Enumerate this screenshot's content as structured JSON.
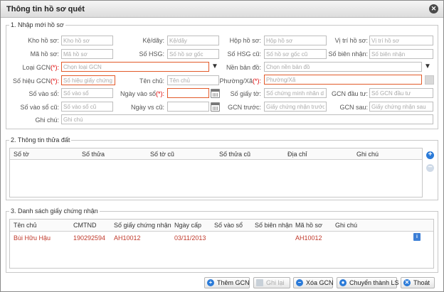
{
  "dialog": {
    "title": "Thông tin hồ sơ quét"
  },
  "section1": {
    "legend": "1. Nhập mới hồ sơ",
    "fields": {
      "kho_ho_so": {
        "label": "Kho hồ sơ:",
        "placeholder": "Kho hồ sơ"
      },
      "ke_day": {
        "label": "Kệ/dãy:",
        "placeholder": "Kệ/dãy"
      },
      "hop_ho_so": {
        "label": "Hộp hồ sơ:",
        "placeholder": "Hộp hồ sơ"
      },
      "vi_tri_ho_so": {
        "label": "Vị trí hồ sơ:",
        "placeholder": "Vị trí hồ sơ"
      },
      "ma_ho_so": {
        "label": "Mã hồ sơ:",
        "placeholder": "Mã hồ sơ"
      },
      "so_hsg": {
        "label": "Số HSG:",
        "placeholder": "Số hồ sơ gốc"
      },
      "so_hsg_cu": {
        "label": "Số HSG cũ:",
        "placeholder": "Số hồ sơ gốc cũ"
      },
      "so_bien_nhan": {
        "label": "Số biên nhận:",
        "placeholder": "Số biên nhận"
      },
      "loai_gcn": {
        "label": "Loại GCN",
        "required": "(*):",
        "placeholder": "Chọn loại GCN"
      },
      "nen_ban_do": {
        "label": "Nền bản đồ:",
        "placeholder": "Chọn nền bản đồ"
      },
      "so_hieu_gcn": {
        "label": "Số hiệu GCN",
        "required": "(*):",
        "placeholder": "Số hiệu giấy chứng"
      },
      "ten_chu": {
        "label": "Tên chủ:",
        "placeholder": "Tên chủ"
      },
      "phuong_xa": {
        "label": "Phường/Xã",
        "required": "(*):",
        "placeholder": "Phường/Xã"
      },
      "so_vao_so": {
        "label": "Số vào sổ:",
        "placeholder": "Số vào sổ"
      },
      "ngay_vao_so": {
        "label": "Ngày vào sổ",
        "required": "(*):",
        "placeholder": ""
      },
      "so_giay_to": {
        "label": "Số giấy tờ:",
        "placeholder": "Số chứng minh nhân d"
      },
      "gcn_dau_tu": {
        "label": "GCN đầu tư:",
        "placeholder": "Số GCN đầu tư"
      },
      "so_vao_so_cu": {
        "label": "Số vào sổ cũ:",
        "placeholder": "Số vào sổ cũ"
      },
      "ngay_vs_cu": {
        "label": "Ngày vs cũ:",
        "placeholder": ""
      },
      "gcn_truoc": {
        "label": "GCN trước:",
        "placeholder": "Giấy chứng nhận trước"
      },
      "gcn_sau": {
        "label": "GCN sau:",
        "placeholder": "Giấy chứng nhận sau"
      },
      "ghi_chu": {
        "label": "Ghi chú:",
        "placeholder": "Ghi chú"
      }
    }
  },
  "section2": {
    "legend": "2. Thông tin thửa đất",
    "columns": [
      "Số tờ",
      "Số thửa",
      "Số tờ cũ",
      "Số thửa cũ",
      "Địa chỉ",
      "Ghi chú"
    ],
    "add_symbol": "+",
    "remove_symbol": "−"
  },
  "section3": {
    "legend": "3. Danh sách giấy chứng nhận",
    "columns": [
      "Tên chủ",
      "CMTND",
      "Số giấy chứng nhận",
      "Ngày cấp",
      "Số vào sổ",
      "Số biên nhận",
      "Mã hồ sơ",
      "Ghi chú"
    ],
    "rows": [
      {
        "ten_chu": "Bùi Hữu Hậu",
        "cmtnd": "190292594",
        "so_gcn": "AH10012",
        "ngay_cap": "03/11/2013",
        "so_vao_so": "",
        "so_bien_nhan": "",
        "ma_ho_so": "AH10012",
        "ghi_chu": ""
      }
    ]
  },
  "footer": {
    "them_gcn": "Thêm GCN",
    "ghi_lai": "Ghi lại",
    "xoa_gcn": "Xóa GCN",
    "chuyen_thanh_ls": "Chuyển thành LS",
    "thoat": "Thoát"
  },
  "colors": {
    "accent": "#2a7ad8",
    "error_border": "#e25a2a",
    "row_red": "#c0392b"
  },
  "icons": {
    "close": "close-icon",
    "add": "add-row-icon",
    "remove": "remove-row-icon",
    "detail": "detail-icon",
    "calendar": "calendar-icon",
    "dropdown": "dropdown-arrow-icon"
  }
}
